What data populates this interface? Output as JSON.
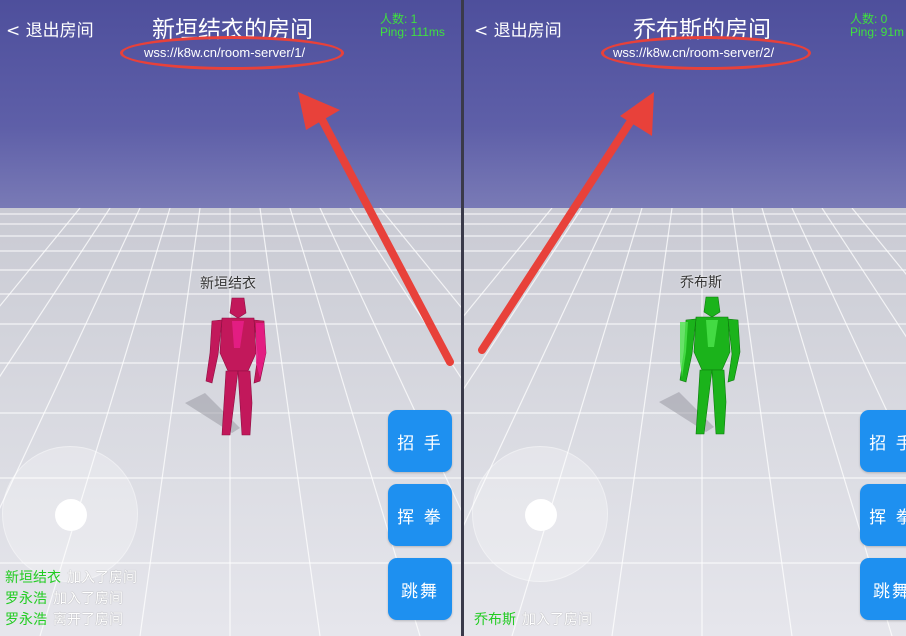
{
  "left_pane": {
    "back_label": "< 退出房间",
    "title": "新垣结衣的房间",
    "url": "wss://k8w.cn/room-server/1/",
    "stats": {
      "people": "人数: 1",
      "ping": "Ping: 111ms"
    },
    "character_name": "新垣结衣",
    "character_color": "#c2185b",
    "buttons": {
      "wave": "招 手",
      "punch": "挥 拳",
      "dance": "跳舞"
    },
    "log": [
      {
        "who": "新垣结衣",
        "what": "加入了房间"
      },
      {
        "who": "罗永浩",
        "what": "加入了房间"
      },
      {
        "who": "罗永浩",
        "what": "离开了房间"
      }
    ]
  },
  "right_pane": {
    "back_label": "< 退出房间",
    "title": "乔布斯的房间",
    "url": "wss://k8w.cn/room-server/2/",
    "stats": {
      "people": "人数: 0",
      "ping": "Ping: 91m"
    },
    "character_name": "乔布斯",
    "character_color": "#1bb31b",
    "buttons": {
      "wave": "招 手",
      "punch": "挥 拳",
      "dance": "跳舞"
    },
    "log": [
      {
        "who": "乔布斯",
        "what": "加入了房间"
      }
    ]
  },
  "colors": {
    "annotation_red": "#e8413a",
    "button_blue": "#1e90f0",
    "stats_green": "#3fe03f",
    "sky": "#5e5fa8"
  }
}
